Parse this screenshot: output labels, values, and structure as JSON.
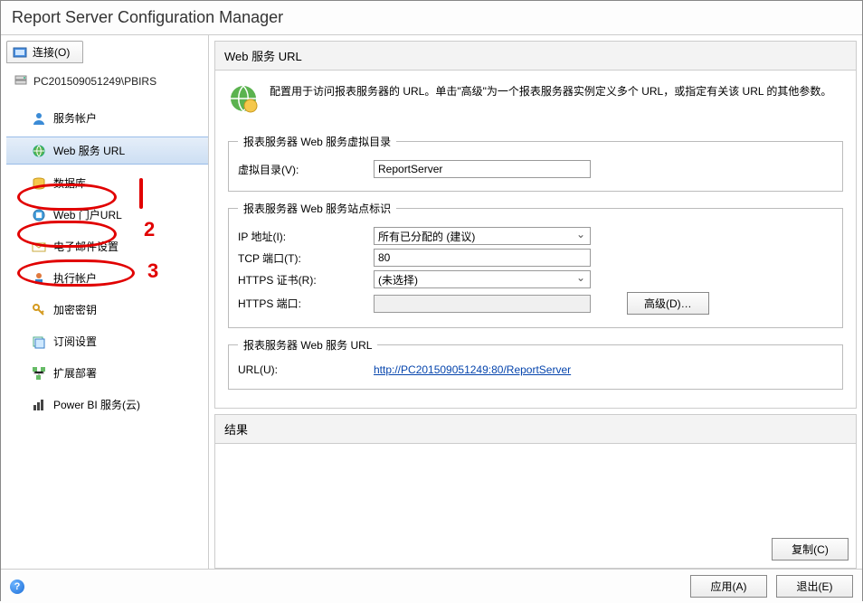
{
  "title": "Report Server Configuration Manager",
  "sidebar": {
    "connect_label": "连接(O)",
    "server_name": "PC201509051249\\PBIRS",
    "items": [
      {
        "label": "服务帐户"
      },
      {
        "label": "Web 服务 URL"
      },
      {
        "label": "数据库"
      },
      {
        "label": "Web 门户URL"
      },
      {
        "label": "电子邮件设置"
      },
      {
        "label": "执行帐户"
      },
      {
        "label": "加密密钥"
      },
      {
        "label": "订阅设置"
      },
      {
        "label": "扩展部署"
      },
      {
        "label": "Power BI 服务(云)"
      }
    ]
  },
  "annotations": {
    "n1": "1",
    "n2": "2",
    "n3": "3"
  },
  "panel": {
    "header": "Web 服务 URL",
    "intro_text": "配置用于访问报表服务器的 URL。单击\"高级\"为一个报表服务器实例定义多个 URL，或指定有关该 URL 的其他参数。",
    "group1_legend": "报表服务器 Web 服务虚拟目录",
    "virtual_dir_label": "虚拟目录(V):",
    "virtual_dir_value": "ReportServer",
    "group2_legend": "报表服务器 Web 服务站点标识",
    "ip_label": "IP 地址(I):",
    "ip_value": "所有已分配的 (建议)",
    "tcp_label": "TCP 端口(T):",
    "tcp_value": "80",
    "https_cert_label": "HTTPS 证书(R):",
    "https_cert_value": "(未选择)",
    "https_port_label": "HTTPS 端口:",
    "https_port_value": "",
    "advanced_btn": "高级(D)…",
    "group3_legend": "报表服务器 Web 服务 URL",
    "url_label": "URL(U):",
    "url_value": "http://PC201509051249:80/ReportServer",
    "results_header": "结果",
    "copy_btn": "复制(C)"
  },
  "footer": {
    "apply": "应用(A)",
    "exit": "退出(E)"
  }
}
